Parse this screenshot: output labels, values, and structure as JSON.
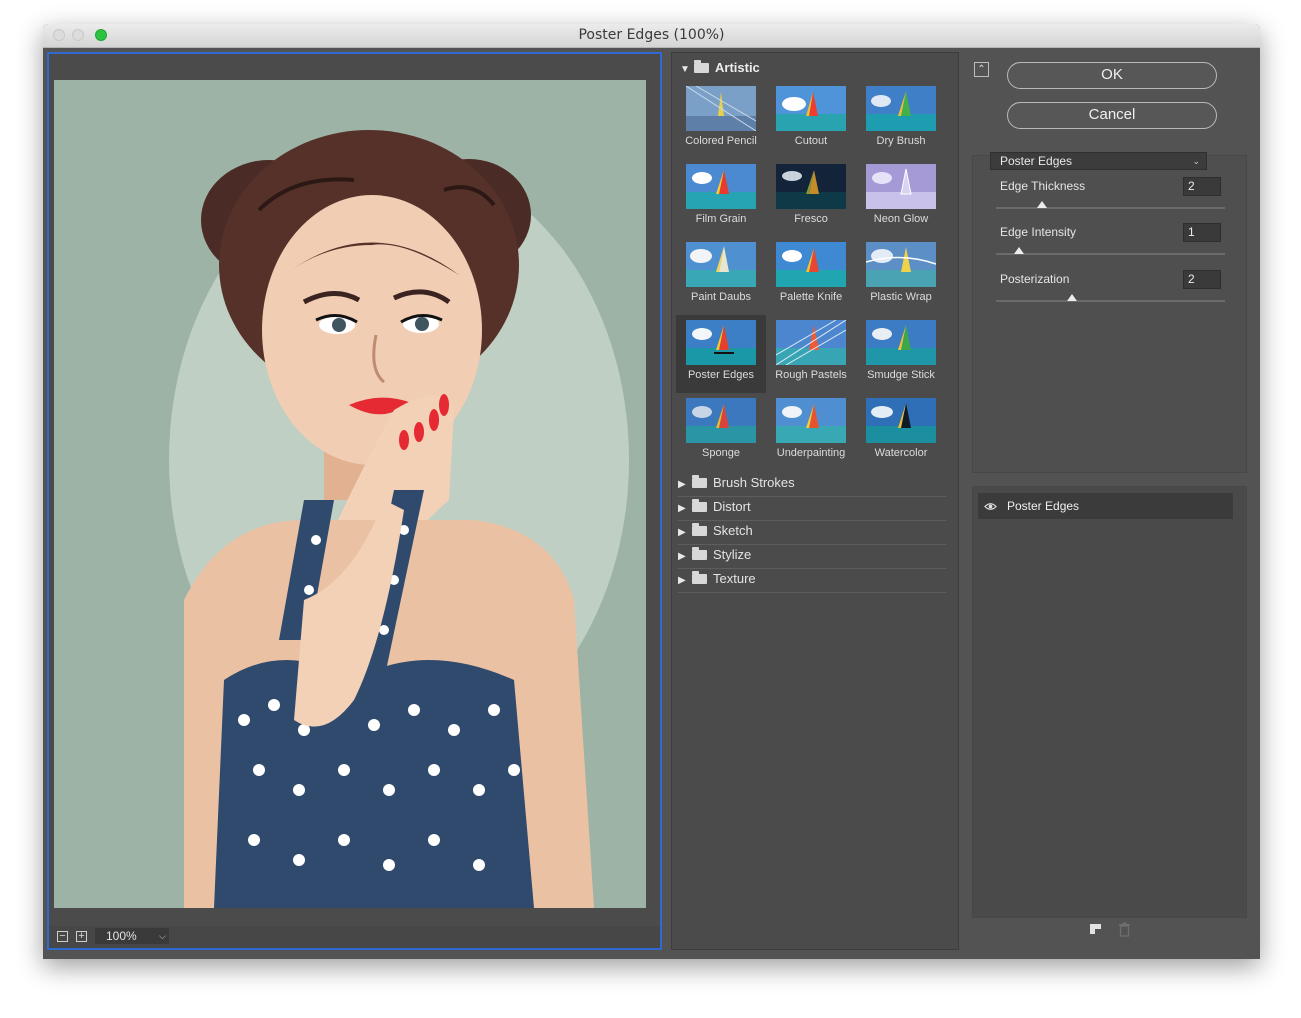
{
  "window": {
    "title": "Poster Edges (100%)"
  },
  "preview": {
    "zoom": "100%",
    "zoom_out": "−",
    "zoom_in": "+"
  },
  "gallery": {
    "artistic": {
      "label": "Artistic",
      "filters": [
        {
          "label": "Colored Pencil"
        },
        {
          "label": "Cutout"
        },
        {
          "label": "Dry Brush"
        },
        {
          "label": "Film Grain"
        },
        {
          "label": "Fresco"
        },
        {
          "label": "Neon Glow"
        },
        {
          "label": "Paint Daubs"
        },
        {
          "label": "Palette Knife"
        },
        {
          "label": "Plastic Wrap"
        },
        {
          "label": "Poster Edges"
        },
        {
          "label": "Rough Pastels"
        },
        {
          "label": "Smudge Stick"
        },
        {
          "label": "Sponge"
        },
        {
          "label": "Underpainting"
        },
        {
          "label": "Watercolor"
        }
      ],
      "selected": "Poster Edges"
    },
    "categories": [
      {
        "label": "Brush Strokes"
      },
      {
        "label": "Distort"
      },
      {
        "label": "Sketch"
      },
      {
        "label": "Stylize"
      },
      {
        "label": "Texture"
      }
    ]
  },
  "buttons": {
    "ok": "OK",
    "cancel": "Cancel"
  },
  "settings": {
    "filter": "Poster Edges",
    "params": [
      {
        "label": "Edge Thickness",
        "value": "2",
        "level": 0.2
      },
      {
        "label": "Edge Intensity",
        "value": "1",
        "level": 0.1
      },
      {
        "label": "Posterization",
        "value": "2",
        "level": 0.33
      }
    ]
  },
  "layers": [
    {
      "label": "Poster Edges"
    }
  ],
  "icons": {
    "visibility": "eye-icon",
    "new_layer": "new-effect-layer-icon",
    "delete": "trash-icon",
    "collapse": "collapse-icon"
  },
  "colors": {
    "accent": "#2f6ad0",
    "panel": "#535353",
    "canvas_bg": "#9db3a5"
  }
}
